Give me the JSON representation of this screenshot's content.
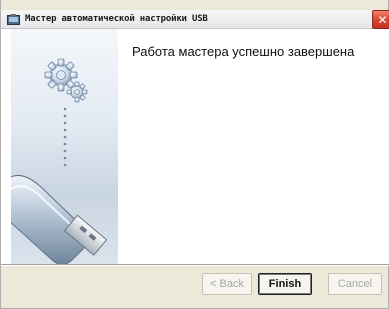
{
  "window": {
    "title": "Мастер автоматической настройки USB",
    "close_label": "✕"
  },
  "main": {
    "headline": "Работа мастера успешно завершена"
  },
  "buttons": {
    "back_label": "< Back",
    "finish_label": "Finish",
    "cancel_label": "Cancel"
  },
  "colors": {
    "side_panel": "#dbe4ee",
    "close_button": "#d8432f",
    "dialog_face": "#ece9d8"
  },
  "icons": {
    "title": "usb-wizard-app-icon",
    "illustration": "usb-flash-drive-with-gears"
  }
}
